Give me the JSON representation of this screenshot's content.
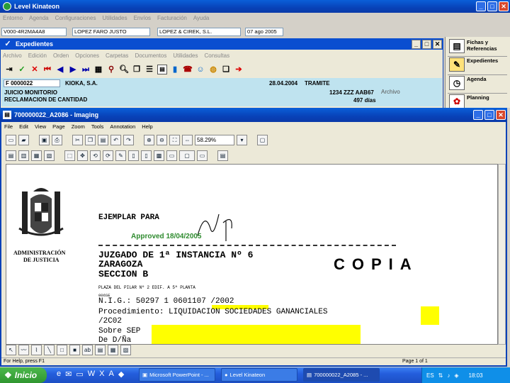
{
  "main_window": {
    "title": "Level Kinateon",
    "menu": [
      "Entorno",
      "Agenda",
      "Configuraciones",
      "Utilidades",
      "Envíos",
      "Facturación",
      "Ayuda"
    ],
    "info_fields": [
      "V000-4R2MA4A8",
      "LOPEZ FARO JUSTO",
      "LOPEZ & CIREK, S.L.",
      "07 ago 2005"
    ]
  },
  "expedientes": {
    "title": "Expedientes",
    "menu": [
      "Archivo",
      "Edición",
      "Orden",
      "Opciones",
      "Carpetas",
      "Documentos",
      "Utilidades",
      "Consultas"
    ],
    "record": {
      "number": "F 0000022",
      "client": "KIOKA, S.A.",
      "date": "28.04.2004",
      "status": "TRAMITE",
      "type": "JUICIO MONITORIO",
      "subtype": "RECLAMACION DE CANTIDAD",
      "amount": "1234 ZZZ AAB67",
      "extra": "Archivo",
      "days": "497 días"
    }
  },
  "sidebar": [
    {
      "label": "Fichas y Referencias",
      "icon": "cards-icon"
    },
    {
      "label": "Expedientes",
      "icon": "folder-icon"
    },
    {
      "label": "Agenda",
      "icon": "clock-icon"
    },
    {
      "label": "Planning",
      "icon": "planning-icon"
    }
  ],
  "imaging": {
    "title": "700000022_A2086 - Imaging",
    "menu": [
      "File",
      "Edit",
      "View",
      "Page",
      "Zoom",
      "Tools",
      "Annotation",
      "Help"
    ],
    "zoom": "58.29%",
    "status_left": "For Help, press F1",
    "status_right": "Page 1 of 1",
    "doc": {
      "header": "EJEMPLAR PARA",
      "stamp": "Approved 18/04/2005",
      "copia": "COPIA",
      "court": "JUZGADO DE 1ª INSTANCIA Nº 6",
      "city": "ZARAGOZA",
      "section": "SECCION B",
      "address": "PLAZA DEL PILAR Nº 2 EDIF. A 5ª PLANTA",
      "nig": "N.I.G.: 50297 1 0601107 /2002",
      "procedure": "Procedimiento:  LIQUIDACION  SOCIEDADES  GANANCIALES",
      "proc_num": "/2C02",
      "about": "Sobre SEP",
      "de": "De D/Ña",
      "admin1": "ADMINISTRACIÓN",
      "admin2": "DE JUSTICIA",
      "ref": "006SE"
    }
  },
  "taskbar": {
    "start": "Inicio",
    "tasks": [
      "Microsoft PowerPoint - ...",
      "Level Kinateon",
      "700000022_A2085 - ..."
    ],
    "lang": "ES",
    "clock": "18:03"
  }
}
